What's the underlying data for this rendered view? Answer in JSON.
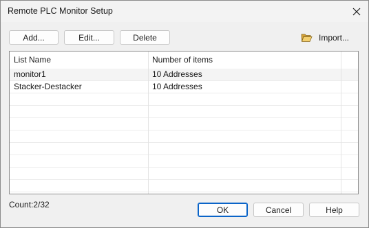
{
  "window": {
    "title": "Remote PLC Monitor Setup",
    "close_icon": "close-icon"
  },
  "toolbar": {
    "add_label": "Add...",
    "edit_label": "Edit...",
    "delete_label": "Delete",
    "import_label": "Import...",
    "import_icon": "open-folder-icon"
  },
  "list": {
    "columns": [
      "List Name",
      "Number of items"
    ],
    "rows": [
      {
        "name": "monitor1",
        "items": "10 Addresses",
        "selected": true
      },
      {
        "name": "Stacker-Destacker",
        "items": "10 Addresses",
        "selected": false
      }
    ]
  },
  "footer": {
    "count": "Count:2/32",
    "ok_label": "OK",
    "cancel_label": "Cancel",
    "help_label": "Help"
  },
  "colors": {
    "default_button_border": "#0a64c8",
    "folder_icon": "#e8b84a"
  }
}
